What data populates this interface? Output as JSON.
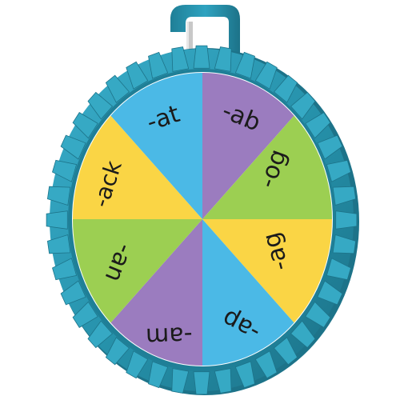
{
  "wheel": {
    "sectors": [
      {
        "label": "-ab",
        "color": "#9b7cbf"
      },
      {
        "label": "-og",
        "color": "#9ccf52"
      },
      {
        "label": "-ag",
        "color": "#fad545"
      },
      {
        "label": "-ap",
        "color": "#4bb9e6"
      },
      {
        "label": "-am",
        "color": "#9b7cbf"
      },
      {
        "label": "-an",
        "color": "#9ccf52"
      },
      {
        "label": "-ack",
        "color": "#fad545"
      },
      {
        "label": "-at",
        "color": "#4bb9e6"
      }
    ],
    "frame_color": "#2590a9",
    "frame_dark": "#1d7389",
    "frame_light": "#36a9c4"
  }
}
